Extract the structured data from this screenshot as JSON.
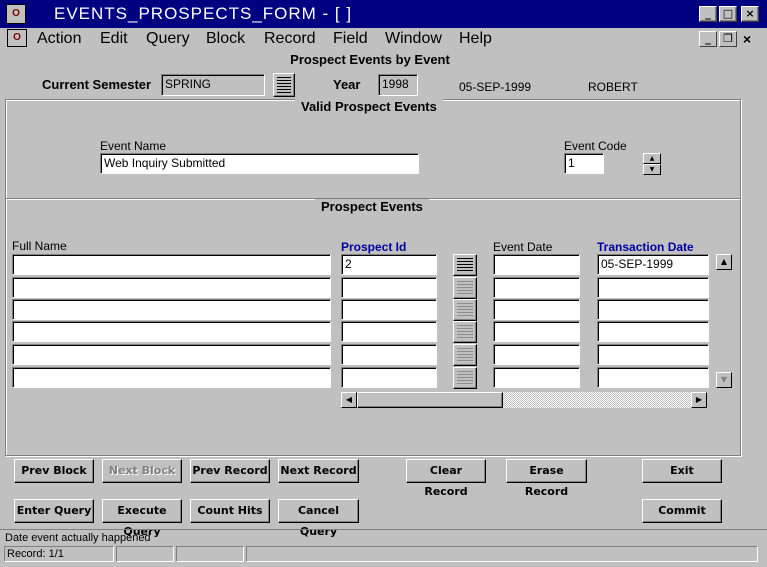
{
  "window": {
    "title": "EVENTS_PROSPECTS_FORM - [ ]",
    "icon": "oracle-forms-icon"
  },
  "menu": [
    "Action",
    "Edit",
    "Query",
    "Block",
    "Record",
    "Field",
    "Window",
    "Help"
  ],
  "form": {
    "title": "Prospect Events by Event",
    "semester_label": "Current Semester",
    "semester_value": "SPRING",
    "year_label": "Year",
    "year_value": "1998",
    "date": "05-SEP-1999",
    "user": "ROBERT"
  },
  "valid_events": {
    "title": "Valid Prospect Events",
    "event_name_label": "Event Name",
    "event_name_value": "Web Inquiry Submitted",
    "event_code_label": "Event Code",
    "event_code_value": "1"
  },
  "prospect_events": {
    "title": "Prospect Events",
    "columns": {
      "full_name": "Full Name",
      "prospect_id": "Prospect Id",
      "event_date": "Event Date",
      "transaction_date": "Transaction Date"
    },
    "rows": [
      {
        "full_name": "",
        "prospect_id": "2",
        "event_date": "",
        "transaction_date": "05-SEP-1999"
      },
      {
        "full_name": "",
        "prospect_id": "",
        "event_date": "",
        "transaction_date": ""
      },
      {
        "full_name": "",
        "prospect_id": "",
        "event_date": "",
        "transaction_date": ""
      },
      {
        "full_name": "",
        "prospect_id": "",
        "event_date": "",
        "transaction_date": ""
      },
      {
        "full_name": "",
        "prospect_id": "",
        "event_date": "",
        "transaction_date": ""
      },
      {
        "full_name": "",
        "prospect_id": "",
        "event_date": "",
        "transaction_date": ""
      }
    ]
  },
  "buttons": {
    "prev_block": "Prev Block",
    "next_block": "Next Block",
    "prev_record": "Prev Record",
    "next_record": "Next Record",
    "clear_record": "Clear Record",
    "erase_record": "Erase Record",
    "exit": "Exit",
    "enter_query": "Enter Query",
    "execute_query": "Execute Query",
    "count_hits": "Count Hits",
    "cancel_query": "Cancel Query",
    "commit": "Commit"
  },
  "status": {
    "message": "Date event actually happened",
    "record": "Record: 1/1"
  },
  "colors": {
    "titlebar": "#000080",
    "face": "#c0c0c0",
    "accent_label": "#0000a0"
  }
}
